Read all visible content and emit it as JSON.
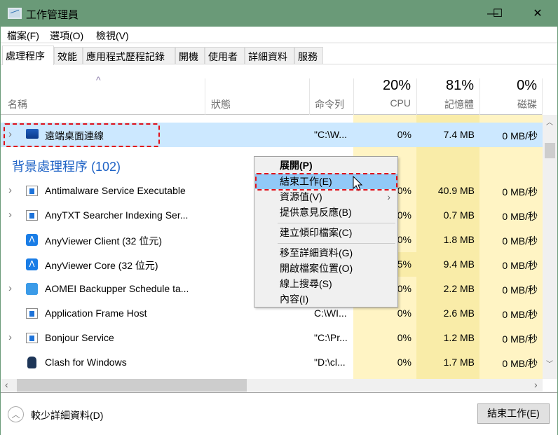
{
  "window": {
    "title": "工作管理員",
    "minimize": "—",
    "maximize": "☐",
    "close": "✕"
  },
  "menu": [
    "檔案(F)",
    "選項(O)",
    "檢視(V)"
  ],
  "tabs": [
    "處理程序",
    "效能",
    "應用程式歷程記錄",
    "開機",
    "使用者",
    "詳細資料",
    "服務"
  ],
  "header": {
    "sort_arrow": "^",
    "name": "名稱",
    "status": "狀態",
    "command": "命令列",
    "cpu_pct": "20%",
    "cpu": "CPU",
    "mem_pct": "81%",
    "mem": "記憶體",
    "disk_pct": "0%",
    "disk": "磁碟"
  },
  "selected_row": {
    "name": "遠端桌面連線",
    "command": "\"C:\\W...",
    "cpu": "0%",
    "memory": "7.4 MB",
    "disk": "0 MB/秒"
  },
  "group_header": "背景處理程序 (102)",
  "processes": [
    {
      "name": "Antimalware Service Executable",
      "command": "",
      "cpu": "0%",
      "memory": "40.9 MB",
      "disk": "0 MB/秒",
      "expand": true,
      "icon": "window"
    },
    {
      "name": "AnyTXT Searcher Indexing Ser...",
      "command": "",
      "cpu": "0%",
      "memory": "0.7 MB",
      "disk": "0 MB/秒",
      "expand": true,
      "icon": "window"
    },
    {
      "name": "AnyViewer Client (32 位元)",
      "command": "",
      "cpu": "0%",
      "memory": "1.8 MB",
      "disk": "0 MB/秒",
      "expand": false,
      "icon": "anyviewer"
    },
    {
      "name": "AnyViewer Core (32 位元)",
      "command": "",
      "cpu": "5%",
      "memory": "9.4 MB",
      "disk": "0 MB/秒",
      "expand": false,
      "icon": "anyviewer"
    },
    {
      "name": "AOMEI Backupper Schedule ta...",
      "command": "",
      "cpu": "0%",
      "memory": "2.2 MB",
      "disk": "0 MB/秒",
      "expand": true,
      "icon": "aomei"
    },
    {
      "name": "Application Frame Host",
      "command": "C:\\WI...",
      "cpu": "0%",
      "memory": "2.6 MB",
      "disk": "0 MB/秒",
      "expand": false,
      "icon": "window"
    },
    {
      "name": "Bonjour Service",
      "command": "\"C:\\Pr...",
      "cpu": "0%",
      "memory": "1.2 MB",
      "disk": "0 MB/秒",
      "expand": true,
      "icon": "window"
    },
    {
      "name": "Clash for Windows",
      "command": "\"D:\\cl...",
      "cpu": "0%",
      "memory": "1.7 MB",
      "disk": "0 MB/秒",
      "expand": false,
      "icon": "cat"
    }
  ],
  "context_menu": [
    "展開(P)",
    "結束工作(E)",
    "資源值(V)",
    "提供意見反應(B)",
    "建立傾印檔案(C)",
    "移至詳細資料(G)",
    "開啟檔案位置(O)",
    "線上搜尋(S)",
    "內容(I)"
  ],
  "footer": {
    "fewer_details": "較少詳細資料(D)",
    "end_task": "結束工作(E)"
  },
  "colors": {
    "titlebar": "#6a9a78",
    "selection": "#cce8ff",
    "menu_highlight": "#91c9f7",
    "cpu_bg": "#fff4c4",
    "mem_bg": "#f9eca8",
    "annotation": "#e0101a"
  }
}
